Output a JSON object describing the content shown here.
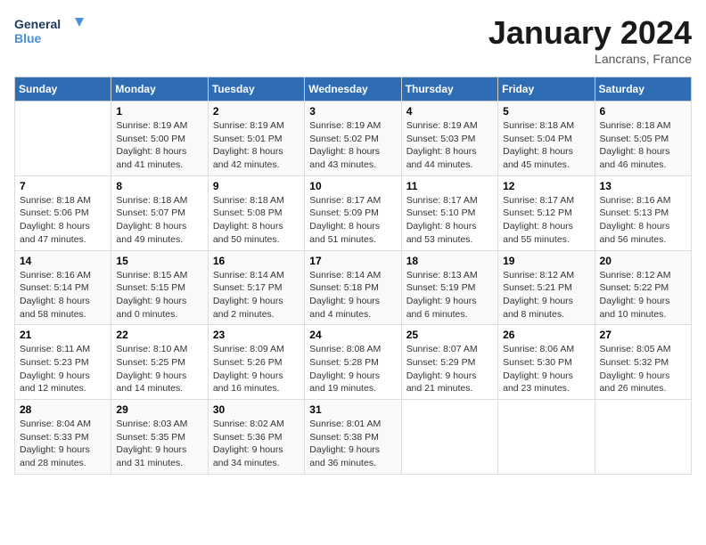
{
  "logo": {
    "line1": "General",
    "line2": "Blue"
  },
  "title": "January 2024",
  "location": "Lancrans, France",
  "days_of_week": [
    "Sunday",
    "Monday",
    "Tuesday",
    "Wednesday",
    "Thursday",
    "Friday",
    "Saturday"
  ],
  "weeks": [
    [
      {
        "day": "",
        "info": ""
      },
      {
        "day": "1",
        "info": "Sunrise: 8:19 AM\nSunset: 5:00 PM\nDaylight: 8 hours\nand 41 minutes."
      },
      {
        "day": "2",
        "info": "Sunrise: 8:19 AM\nSunset: 5:01 PM\nDaylight: 8 hours\nand 42 minutes."
      },
      {
        "day": "3",
        "info": "Sunrise: 8:19 AM\nSunset: 5:02 PM\nDaylight: 8 hours\nand 43 minutes."
      },
      {
        "day": "4",
        "info": "Sunrise: 8:19 AM\nSunset: 5:03 PM\nDaylight: 8 hours\nand 44 minutes."
      },
      {
        "day": "5",
        "info": "Sunrise: 8:18 AM\nSunset: 5:04 PM\nDaylight: 8 hours\nand 45 minutes."
      },
      {
        "day": "6",
        "info": "Sunrise: 8:18 AM\nSunset: 5:05 PM\nDaylight: 8 hours\nand 46 minutes."
      }
    ],
    [
      {
        "day": "7",
        "info": "Sunrise: 8:18 AM\nSunset: 5:06 PM\nDaylight: 8 hours\nand 47 minutes."
      },
      {
        "day": "8",
        "info": "Sunrise: 8:18 AM\nSunset: 5:07 PM\nDaylight: 8 hours\nand 49 minutes."
      },
      {
        "day": "9",
        "info": "Sunrise: 8:18 AM\nSunset: 5:08 PM\nDaylight: 8 hours\nand 50 minutes."
      },
      {
        "day": "10",
        "info": "Sunrise: 8:17 AM\nSunset: 5:09 PM\nDaylight: 8 hours\nand 51 minutes."
      },
      {
        "day": "11",
        "info": "Sunrise: 8:17 AM\nSunset: 5:10 PM\nDaylight: 8 hours\nand 53 minutes."
      },
      {
        "day": "12",
        "info": "Sunrise: 8:17 AM\nSunset: 5:12 PM\nDaylight: 8 hours\nand 55 minutes."
      },
      {
        "day": "13",
        "info": "Sunrise: 8:16 AM\nSunset: 5:13 PM\nDaylight: 8 hours\nand 56 minutes."
      }
    ],
    [
      {
        "day": "14",
        "info": "Sunrise: 8:16 AM\nSunset: 5:14 PM\nDaylight: 8 hours\nand 58 minutes."
      },
      {
        "day": "15",
        "info": "Sunrise: 8:15 AM\nSunset: 5:15 PM\nDaylight: 9 hours\nand 0 minutes."
      },
      {
        "day": "16",
        "info": "Sunrise: 8:14 AM\nSunset: 5:17 PM\nDaylight: 9 hours\nand 2 minutes."
      },
      {
        "day": "17",
        "info": "Sunrise: 8:14 AM\nSunset: 5:18 PM\nDaylight: 9 hours\nand 4 minutes."
      },
      {
        "day": "18",
        "info": "Sunrise: 8:13 AM\nSunset: 5:19 PM\nDaylight: 9 hours\nand 6 minutes."
      },
      {
        "day": "19",
        "info": "Sunrise: 8:12 AM\nSunset: 5:21 PM\nDaylight: 9 hours\nand 8 minutes."
      },
      {
        "day": "20",
        "info": "Sunrise: 8:12 AM\nSunset: 5:22 PM\nDaylight: 9 hours\nand 10 minutes."
      }
    ],
    [
      {
        "day": "21",
        "info": "Sunrise: 8:11 AM\nSunset: 5:23 PM\nDaylight: 9 hours\nand 12 minutes."
      },
      {
        "day": "22",
        "info": "Sunrise: 8:10 AM\nSunset: 5:25 PM\nDaylight: 9 hours\nand 14 minutes."
      },
      {
        "day": "23",
        "info": "Sunrise: 8:09 AM\nSunset: 5:26 PM\nDaylight: 9 hours\nand 16 minutes."
      },
      {
        "day": "24",
        "info": "Sunrise: 8:08 AM\nSunset: 5:28 PM\nDaylight: 9 hours\nand 19 minutes."
      },
      {
        "day": "25",
        "info": "Sunrise: 8:07 AM\nSunset: 5:29 PM\nDaylight: 9 hours\nand 21 minutes."
      },
      {
        "day": "26",
        "info": "Sunrise: 8:06 AM\nSunset: 5:30 PM\nDaylight: 9 hours\nand 23 minutes."
      },
      {
        "day": "27",
        "info": "Sunrise: 8:05 AM\nSunset: 5:32 PM\nDaylight: 9 hours\nand 26 minutes."
      }
    ],
    [
      {
        "day": "28",
        "info": "Sunrise: 8:04 AM\nSunset: 5:33 PM\nDaylight: 9 hours\nand 28 minutes."
      },
      {
        "day": "29",
        "info": "Sunrise: 8:03 AM\nSunset: 5:35 PM\nDaylight: 9 hours\nand 31 minutes."
      },
      {
        "day": "30",
        "info": "Sunrise: 8:02 AM\nSunset: 5:36 PM\nDaylight: 9 hours\nand 34 minutes."
      },
      {
        "day": "31",
        "info": "Sunrise: 8:01 AM\nSunset: 5:38 PM\nDaylight: 9 hours\nand 36 minutes."
      },
      {
        "day": "",
        "info": ""
      },
      {
        "day": "",
        "info": ""
      },
      {
        "day": "",
        "info": ""
      }
    ]
  ]
}
